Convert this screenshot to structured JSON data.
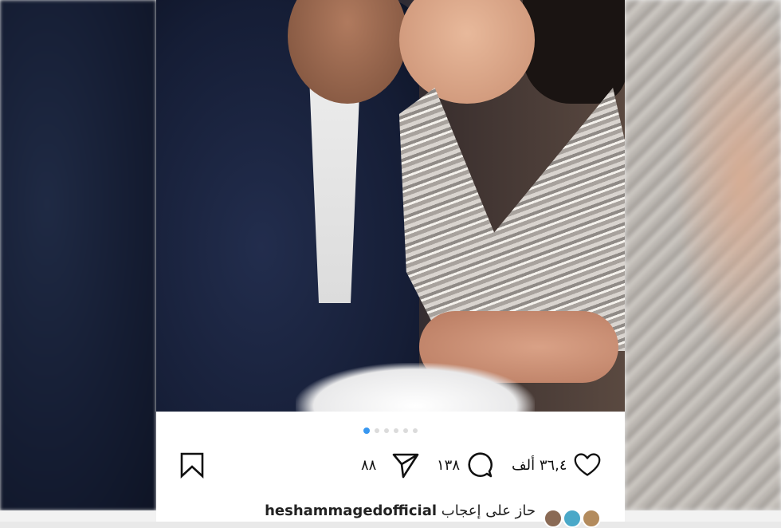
{
  "post": {
    "carousel": {
      "total_slides": 6,
      "active_index": 0
    },
    "actions": {
      "likes_count": "٣٦,٤ ألف",
      "comments_count": "١٣٨",
      "shares_count": "٨٨"
    },
    "liked_by": {
      "prefix": "حاز على إعجاب",
      "username": "heshammagedofficial"
    },
    "icons": [
      "heart-icon",
      "comment-icon",
      "share-icon",
      "bookmark-icon"
    ],
    "colors": {
      "active_dot": "#3897f0",
      "inactive_dot": "#dbdbdb",
      "icon": "#111111"
    }
  }
}
